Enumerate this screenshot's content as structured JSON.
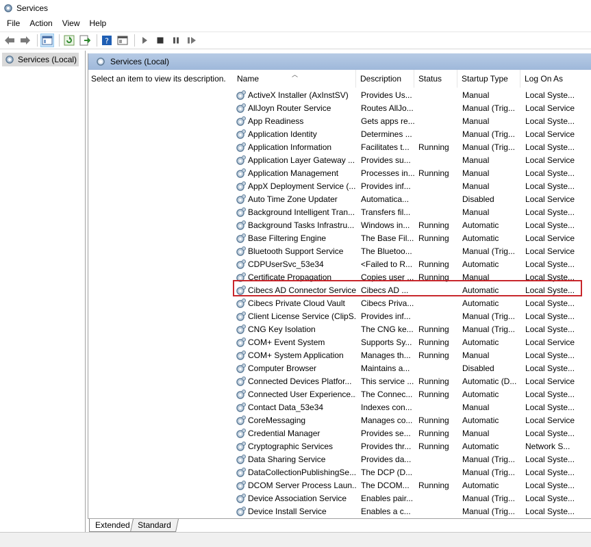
{
  "window": {
    "title": "Services"
  },
  "menu": [
    "File",
    "Action",
    "View",
    "Help"
  ],
  "tree": {
    "label": "Services (Local)"
  },
  "panel": {
    "header": "Services (Local)",
    "description": "Select an item to view its description."
  },
  "columns": [
    "Name",
    "Description",
    "Status",
    "Startup Type",
    "Log On As"
  ],
  "rows": [
    [
      "ActiveX Installer (AxInstSV)",
      "Provides Us...",
      "",
      "Manual",
      "Local Syste..."
    ],
    [
      "AllJoyn Router Service",
      "Routes AllJo...",
      "",
      "Manual (Trig...",
      "Local Service"
    ],
    [
      "App Readiness",
      "Gets apps re...",
      "",
      "Manual",
      "Local Syste..."
    ],
    [
      "Application Identity",
      "Determines ...",
      "",
      "Manual (Trig...",
      "Local Service"
    ],
    [
      "Application Information",
      "Facilitates t...",
      "Running",
      "Manual (Trig...",
      "Local Syste..."
    ],
    [
      "Application Layer Gateway ...",
      "Provides su...",
      "",
      "Manual",
      "Local Service"
    ],
    [
      "Application Management",
      "Processes in...",
      "Running",
      "Manual",
      "Local Syste..."
    ],
    [
      "AppX Deployment Service (...",
      "Provides inf...",
      "",
      "Manual",
      "Local Syste..."
    ],
    [
      "Auto Time Zone Updater",
      "Automatica...",
      "",
      "Disabled",
      "Local Service"
    ],
    [
      "Background Intelligent Tran...",
      "Transfers fil...",
      "",
      "Manual",
      "Local Syste..."
    ],
    [
      "Background Tasks Infrastru...",
      "Windows in...",
      "Running",
      "Automatic",
      "Local Syste..."
    ],
    [
      "Base Filtering Engine",
      "The Base Fil...",
      "Running",
      "Automatic",
      "Local Service"
    ],
    [
      "Bluetooth Support Service",
      "The Bluetoo...",
      "",
      "Manual (Trig...",
      "Local Service"
    ],
    [
      "CDPUserSvc_53e34",
      "<Failed to R...",
      "Running",
      "Automatic",
      "Local Syste..."
    ],
    [
      "Certificate Propagation",
      "Copies user ...",
      "Running",
      "Manual",
      "Local Syste..."
    ],
    [
      "Cibecs AD Connector Service",
      "Cibecs AD ...",
      "",
      "Automatic",
      "Local Syste..."
    ],
    [
      "Cibecs Private Cloud Vault",
      "Cibecs Priva...",
      "",
      "Automatic",
      "Local Syste..."
    ],
    [
      "Client License Service (ClipS...",
      "Provides inf...",
      "",
      "Manual (Trig...",
      "Local Syste..."
    ],
    [
      "CNG Key Isolation",
      "The CNG ke...",
      "Running",
      "Manual (Trig...",
      "Local Syste..."
    ],
    [
      "COM+ Event System",
      "Supports Sy...",
      "Running",
      "Automatic",
      "Local Service"
    ],
    [
      "COM+ System Application",
      "Manages th...",
      "Running",
      "Manual",
      "Local Syste..."
    ],
    [
      "Computer Browser",
      "Maintains a...",
      "",
      "Disabled",
      "Local Syste..."
    ],
    [
      "Connected Devices Platfor...",
      "This service ...",
      "Running",
      "Automatic (D...",
      "Local Service"
    ],
    [
      "Connected User Experience...",
      "The Connec...",
      "Running",
      "Automatic",
      "Local Syste..."
    ],
    [
      "Contact Data_53e34",
      "Indexes con...",
      "",
      "Manual",
      "Local Syste..."
    ],
    [
      "CoreMessaging",
      "Manages co...",
      "Running",
      "Automatic",
      "Local Service"
    ],
    [
      "Credential Manager",
      "Provides se...",
      "Running",
      "Manual",
      "Local Syste..."
    ],
    [
      "Cryptographic Services",
      "Provides thr...",
      "Running",
      "Automatic",
      "Network S..."
    ],
    [
      "Data Sharing Service",
      "Provides da...",
      "",
      "Manual (Trig...",
      "Local Syste..."
    ],
    [
      "DataCollectionPublishingSe...",
      "The DCP (D...",
      "",
      "Manual (Trig...",
      "Local Syste..."
    ],
    [
      "DCOM Server Process Laun...",
      "The DCOM...",
      "Running",
      "Automatic",
      "Local Syste..."
    ],
    [
      "Device Association Service",
      "Enables pair...",
      "",
      "Manual (Trig...",
      "Local Syste..."
    ],
    [
      "Device Install Service",
      "Enables a c...",
      "",
      "Manual (Trig...",
      "Local Syste..."
    ]
  ],
  "tabs": {
    "extended": "Extended",
    "standard": "Standard"
  },
  "colors": {
    "highlight_border": "#c8262b",
    "header_band": "#b7cbe5"
  },
  "icons": [
    "back-icon",
    "forward-icon",
    "show-tree-icon",
    "refresh-icon",
    "export-icon",
    "help-icon",
    "properties-icon",
    "play-icon",
    "stop-icon",
    "pause-icon",
    "restart-icon",
    "gear-icon"
  ]
}
